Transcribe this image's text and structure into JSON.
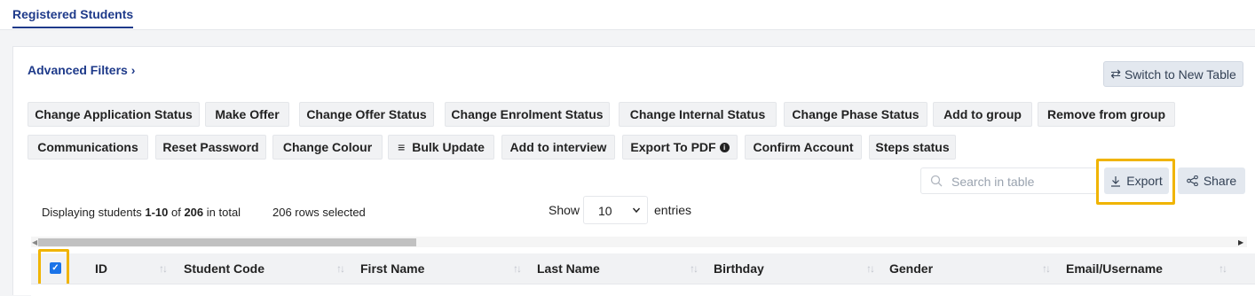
{
  "tab": {
    "label": "Registered Students"
  },
  "advanced_filters": {
    "label": "Advanced Filters",
    "chevron": "chevron-right-icon"
  },
  "switch_table": {
    "icon": "swap-arrows-icon",
    "label": "Switch to New Table"
  },
  "action_buttons_row1": [
    "Change Application Status",
    "Make Offer",
    "Change Offer Status",
    "Change Enrolment Status",
    "Change Internal Status",
    "Change Phase Status",
    "Add to group",
    "Remove from group"
  ],
  "action_buttons_row2": [
    "Communications",
    "Reset Password",
    "Change Colour",
    "Bulk Update",
    "Add to interview",
    "Export To PDF",
    "Confirm Account",
    "Steps status"
  ],
  "search": {
    "placeholder": "Search in table",
    "icon": "search-icon"
  },
  "export": {
    "label": "Export",
    "icon": "download-icon"
  },
  "share": {
    "label": "Share",
    "icon": "share-icon"
  },
  "summary": {
    "prefix": "Displaying students ",
    "range": "1-10",
    "of": " of ",
    "total": "206",
    "suffix": " in total",
    "selected": "206 rows selected"
  },
  "page_size": {
    "show_label": "Show",
    "value": "10",
    "entries_label": "entries"
  },
  "table": {
    "select_all_checked": true,
    "columns": [
      "ID",
      "Student Code",
      "First Name",
      "Last Name",
      "Birthday",
      "Gender",
      "Email/Username"
    ]
  },
  "colors": {
    "accent": "#1e3a8a",
    "highlight": "#f0b400",
    "checkbox": "#1a73e8"
  }
}
